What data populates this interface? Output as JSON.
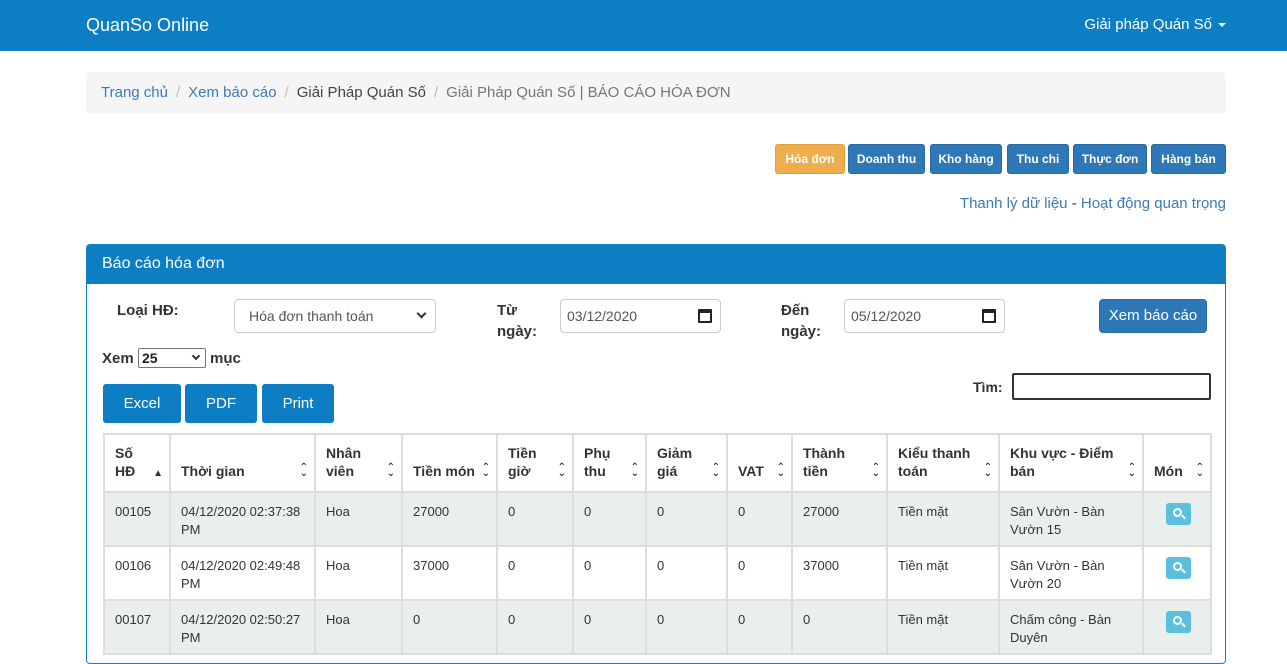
{
  "navbar": {
    "brand": "QuanSo Online",
    "menu": "Giải pháp Quán Số"
  },
  "breadcrumb": [
    "Trang chủ",
    "Xem báo cáo",
    "Giải Pháp Quán Số",
    "Giải Pháp Quán Số | BÁO CÁO HÓA ĐƠN"
  ],
  "report_tabs": [
    "Hóa đơn",
    "Doanh thu",
    "Kho hàng",
    "Thu chi",
    "Thực đơn",
    "Hàng bán"
  ],
  "links": {
    "left": "Thanh lý dữ liệu",
    "sep": " - ",
    "right": "Hoạt động quan trọng"
  },
  "panel": {
    "title": "Báo cáo hóa đơn",
    "type_label": "Loại HĐ:",
    "type_value": "Hóa đơn thanh toán",
    "from_label_1": "Từ",
    "from_label_2": "ngày:",
    "from_value": "03/12/2020",
    "to_label_1": "Đến",
    "to_label_2": "ngày:",
    "to_value": "05/12/2020",
    "view_button": "Xem báo cáo",
    "show_prefix": "Xem",
    "page_size": "25",
    "show_suffix": "mục",
    "search_label": "Tìm:",
    "export_buttons": [
      "Excel",
      "PDF",
      "Print"
    ]
  },
  "table": {
    "headers": [
      [
        "Số",
        "HĐ"
      ],
      [
        "Thời gian",
        ""
      ],
      [
        "Nhân",
        "viên"
      ],
      [
        "Tiền món",
        ""
      ],
      [
        "Tiền",
        "giờ"
      ],
      [
        "Phụ",
        "thu"
      ],
      [
        "Giảm",
        "giá"
      ],
      [
        "VAT",
        ""
      ],
      [
        "Thành",
        "tiền"
      ],
      [
        "Kiểu thanh",
        "toán"
      ],
      [
        "Khu vực - Điểm",
        "bán"
      ],
      [
        "Món",
        ""
      ]
    ],
    "rows": [
      {
        "so_hd": "00105",
        "time": [
          "04/12/2020 02:37:38",
          "PM"
        ],
        "staff": "Hoa",
        "tien_mon": "27000",
        "tien_gio": "0",
        "phu_thu": "0",
        "giam_gia": "0",
        "vat": "0",
        "thanh_tien": "27000",
        "payment": "Tiền mặt",
        "area": [
          "Sân Vườn - Bàn",
          "Vườn 15"
        ]
      },
      {
        "so_hd": "00106",
        "time": [
          "04/12/2020 02:49:48",
          "PM"
        ],
        "staff": "Hoa",
        "tien_mon": "37000",
        "tien_gio": "0",
        "phu_thu": "0",
        "giam_gia": "0",
        "vat": "0",
        "thanh_tien": "37000",
        "payment": "Tiền mặt",
        "area": [
          "Sân Vườn - Bàn",
          "Vườn 20"
        ]
      },
      {
        "so_hd": "00107",
        "time": [
          "04/12/2020 02:50:27",
          "PM"
        ],
        "staff": "Hoa",
        "tien_mon": "0",
        "tien_gio": "0",
        "phu_thu": "0",
        "giam_gia": "0",
        "vat": "0",
        "thanh_tien": "0",
        "payment": "Tiền mặt",
        "area": [
          "Chấm công - Bàn",
          "Duyên"
        ]
      }
    ]
  },
  "colors": {
    "primary": "#0d7ec4",
    "active_tab": "#efad4d",
    "info": "#5bc0de",
    "row_stripe": "#e8efed"
  }
}
